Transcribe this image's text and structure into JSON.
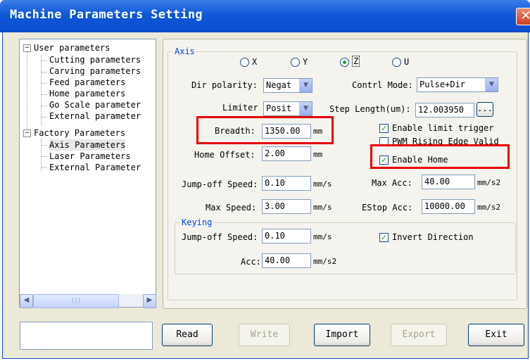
{
  "window": {
    "title": "Machine Parameters Setting",
    "close_glyph": "✕"
  },
  "tree": {
    "items": [
      {
        "label": "User parameters",
        "toggle": "−"
      },
      {
        "label": "Cutting parameters"
      },
      {
        "label": "Carving parameters"
      },
      {
        "label": "Feed parameters"
      },
      {
        "label": "Home parameters"
      },
      {
        "label": "Go Scale parameter"
      },
      {
        "label": "External parameter"
      },
      {
        "label": "Factory Parameters",
        "toggle": "−"
      },
      {
        "label": "Axis Parameters",
        "selected": true
      },
      {
        "label": "Laser Parameters"
      },
      {
        "label": "External Parameter"
      }
    ],
    "scroll_left": "◀",
    "scroll_right": "▶",
    "thumb_grip": "|||"
  },
  "axis": {
    "group_title": "Axis",
    "radios": [
      {
        "label": "X",
        "checked": false
      },
      {
        "label": "Y",
        "checked": false
      },
      {
        "label": "Z",
        "checked": true
      },
      {
        "label": "U",
        "checked": false
      }
    ],
    "dir_polarity": {
      "label": "Dir polarity:",
      "value": "Negat"
    },
    "control_mode": {
      "label": "Contrl Mode:",
      "value": "Pulse+Dir"
    },
    "limiter": {
      "label": "Limiter",
      "value": "Posit"
    },
    "step_length": {
      "label": "Step Length(um):",
      "value": "12.003950",
      "button": "..."
    },
    "breadth": {
      "label": "Breadth:",
      "value": "1350.00",
      "unit": "mm"
    },
    "enable_limit_trigger": {
      "label": "Enable limit trigger",
      "checked": true
    },
    "pwm_rising": {
      "label": "PWM Rising Edge Valid",
      "checked": false
    },
    "home_offset": {
      "label": "Home Offset:",
      "value": "2.00",
      "unit": "mm"
    },
    "enable_home": {
      "label": "Enable Home",
      "checked": true
    },
    "jump_off_speed": {
      "label": "Jump-off Speed:",
      "value": "0.10",
      "unit": "mm/s"
    },
    "max_acc": {
      "label": "Max Acc:",
      "value": "40.00",
      "unit": "mm/s2"
    },
    "max_speed": {
      "label": "Max Speed:",
      "value": "3.00",
      "unit": "mm/s"
    },
    "estop_acc": {
      "label": "EStop Acc:",
      "value": "10000.00",
      "unit": "mm/s2"
    }
  },
  "keying": {
    "group_title": "Keying",
    "jump_off_speed": {
      "label": "Jump-off Speed:",
      "value": "0.10",
      "unit": "mm/s"
    },
    "invert_direction": {
      "label": "Invert Direction",
      "checked": true
    },
    "acc": {
      "label": "Acc:",
      "value": "40.00",
      "unit": "mm/s2"
    }
  },
  "buttons": {
    "read": "Read",
    "write": "Write",
    "import": "Import",
    "export": "Export",
    "exit": "Exit"
  },
  "glyphs": {
    "check": "✓",
    "dropdown": "▼"
  },
  "colors": {
    "titlebar": "#0a4ccc",
    "highlight": "#e50000",
    "group_title": "#0046d5"
  }
}
